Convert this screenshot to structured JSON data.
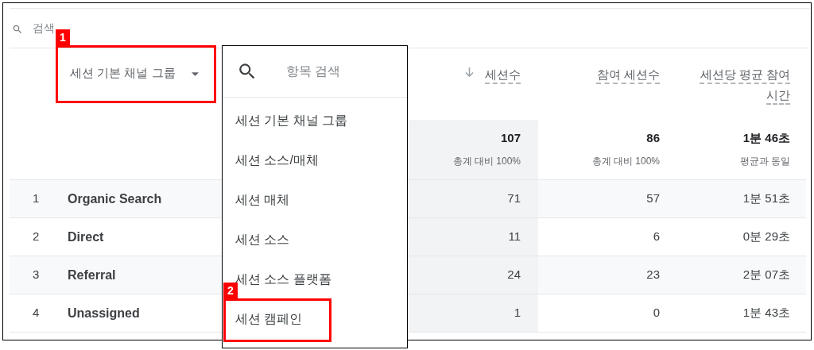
{
  "search": {
    "placeholder": "검색"
  },
  "table": {
    "dimension_header": {
      "label": "세션 기본 채널 그룹"
    },
    "columns": [
      {
        "label": "세션수",
        "sorted": true
      },
      {
        "label": "참여 세션수",
        "sorted": false
      },
      {
        "label": "세션당 평균 참여 시간",
        "sorted": false
      }
    ],
    "totals": [
      {
        "value": "107",
        "note": "총계 대비 100%"
      },
      {
        "value": "86",
        "note": "총계 대비 100%"
      },
      {
        "value": "1분 46초",
        "note": "평균과 동일"
      }
    ],
    "rows": [
      {
        "index": "1",
        "name": "Organic Search",
        "values": [
          "71",
          "57",
          "1분 51초"
        ]
      },
      {
        "index": "2",
        "name": "Direct",
        "values": [
          "11",
          "6",
          "0분 29초"
        ]
      },
      {
        "index": "3",
        "name": "Referral",
        "values": [
          "24",
          "23",
          "2분 07초"
        ]
      },
      {
        "index": "4",
        "name": "Unassigned",
        "values": [
          "1",
          "0",
          "1분 43초"
        ]
      }
    ]
  },
  "dropdown": {
    "placeholder": "항목 검색",
    "items": [
      {
        "label": "세션 기본 채널 그룹"
      },
      {
        "label": "세션 소스/매체"
      },
      {
        "label": "세션 매체"
      },
      {
        "label": "세션 소스"
      },
      {
        "label": "세션 소스 플랫폼"
      },
      {
        "label": "세션 캠페인"
      }
    ]
  },
  "callouts": [
    {
      "label": "1"
    },
    {
      "label": "2"
    }
  ]
}
